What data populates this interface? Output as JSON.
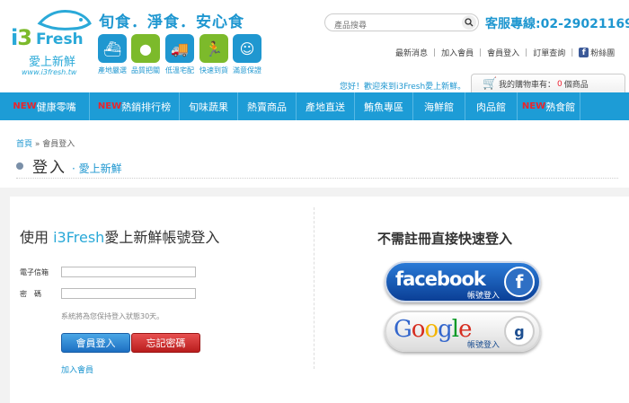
{
  "logo": {
    "i": "i",
    "three": "3",
    "fresh": "Fresh",
    "sub": "愛上新鮮",
    "url": "www.i3fresh.tw"
  },
  "slogan": "旬食．淨食．安心食",
  "features": [
    {
      "label": "產地嚴選",
      "icon": "farm-icon",
      "color": "#1f97d0",
      "glyph": "⛴"
    },
    {
      "label": "品質把關",
      "icon": "tomato-icon",
      "color": "#7cba2b",
      "glyph": "●"
    },
    {
      "label": "低溫宅配",
      "icon": "truck-icon",
      "color": "#1f97d0",
      "glyph": "🚚"
    },
    {
      "label": "快速到貨",
      "icon": "runner-icon",
      "color": "#7cba2b",
      "glyph": "🏃"
    },
    {
      "label": "滿意保證",
      "icon": "smile-icon",
      "color": "#1f97d0",
      "glyph": "☺"
    }
  ],
  "search": {
    "placeholder": "產品搜尋"
  },
  "hotline": "客服專線:02-29021169",
  "top_links": {
    "news": "最新消息",
    "join": "加入會員",
    "login": "會員登入",
    "order": "訂單查詢",
    "fans": "粉絲團"
  },
  "welcome": "您好！歡迎來到i3Fresh愛上新鮮。",
  "cart": {
    "prefix": "我的購物車有：",
    "count": "0",
    "suffix": "個商品"
  },
  "nav": [
    {
      "new": "NEW",
      "label": "健康零嘴",
      "width": 100
    },
    {
      "new": "NEW",
      "label": "熱銷排行榜",
      "width": 100
    },
    {
      "new": "",
      "label": "旬味蔬果",
      "width": 65
    },
    {
      "new": "",
      "label": "熱賣商品",
      "width": 65
    },
    {
      "new": "",
      "label": "產地直送",
      "width": 65
    },
    {
      "new": "",
      "label": "鮪魚專區",
      "width": 65
    },
    {
      "new": "",
      "label": "海鮮館",
      "width": 58
    },
    {
      "new": "",
      "label": "肉品館",
      "width": 58
    },
    {
      "new": "NEW",
      "label": "熟食館",
      "width": 70
    }
  ],
  "breadcrumb": {
    "home": "首頁",
    "sep": " » ",
    "current": "會員登入"
  },
  "title": {
    "main": "登入",
    "sub": "· 愛上新鮮"
  },
  "form": {
    "title_prefix": "使用 ",
    "title_brand": "i3Fresh",
    "title_suffix": "愛上新鮮帳號登入",
    "email_label": "電子信箱",
    "email_value": "",
    "password_label": "密　碼",
    "password_value": "",
    "hint": "系統將為您保持登入狀態30天。",
    "login_button": "會員登入",
    "forgot_button": "忘記密碼",
    "join_link": "加入會員"
  },
  "social": {
    "title": "不需註冊直接快速登入",
    "facebook_word": "facebook",
    "facebook_sub": "帳號登入",
    "facebook_badge": "f",
    "google_sub": "帳號登入",
    "google_badge": "g"
  }
}
